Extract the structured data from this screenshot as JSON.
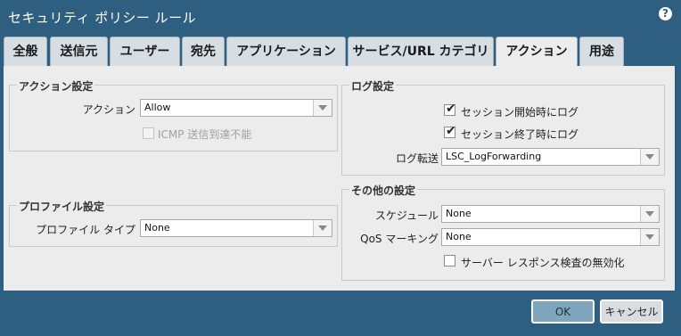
{
  "window": {
    "title": "セキュリティ ポリシー ルール",
    "help_icon": "?"
  },
  "tabs": [
    {
      "label": "全般",
      "active": false
    },
    {
      "label": "送信元",
      "active": false
    },
    {
      "label": "ユーザー",
      "active": false
    },
    {
      "label": "宛先",
      "active": false
    },
    {
      "label": "アプリケーション",
      "active": false
    },
    {
      "label": "サービス/URL カテゴリ",
      "active": false
    },
    {
      "label": "アクション",
      "active": true
    },
    {
      "label": "用途",
      "active": false
    }
  ],
  "action_settings": {
    "legend": "アクション設定",
    "action_label": "アクション",
    "action_value": "Allow",
    "icmp_label": "ICMP 送信到達不能",
    "icmp_checked": false
  },
  "profile_settings": {
    "legend": "プロファイル設定",
    "type_label": "プロファイル タイプ",
    "type_value": "None"
  },
  "log_settings": {
    "legend": "ログ設定",
    "log_start_label": "セッション開始時にログ",
    "log_start_checked": true,
    "log_end_label": "セッション終了時にログ",
    "log_end_checked": true,
    "forwarding_label": "ログ転送",
    "forwarding_value": "LSC_LogForwarding"
  },
  "other_settings": {
    "legend": "その他の設定",
    "schedule_label": "スケジュール",
    "schedule_value": "None",
    "qos_label": "QoS マーキング",
    "qos_value": "None",
    "disable_inspection_label": "サーバー レスポンス検査の無効化",
    "disable_inspection_checked": false
  },
  "buttons": {
    "ok": "OK",
    "cancel": "キャンセル"
  },
  "colors": {
    "titlebar": "#2e5f80",
    "panel": "#ececec",
    "ok_button": "#7fa6bc"
  }
}
